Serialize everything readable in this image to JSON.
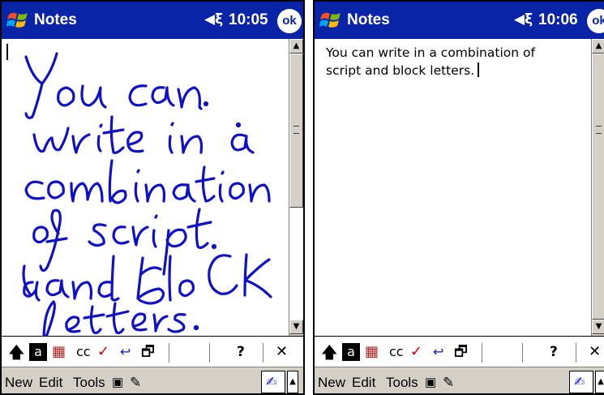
{
  "left_screen": {
    "title": "Notes",
    "clock": "10:05",
    "ok_label": "ok",
    "handwriting_lines": [
      "You can",
      "write in a",
      "combination",
      "of script",
      "and block",
      "letters."
    ],
    "handwriting_color": "#1010c8"
  },
  "right_screen": {
    "title": "Notes",
    "clock": "10:06",
    "ok_label": "ok",
    "typed_line_1": "You can write in a combination of",
    "typed_line_2": "script and block letters."
  },
  "toolbar": {
    "help_label": "?",
    "close_label": "✕"
  },
  "menu": {
    "new_label": "New",
    "edit_label": "Edit",
    "tools_label": "Tools"
  },
  "colors": {
    "titlebar": "#0a24a8",
    "menubar": "#d4d0c8"
  }
}
